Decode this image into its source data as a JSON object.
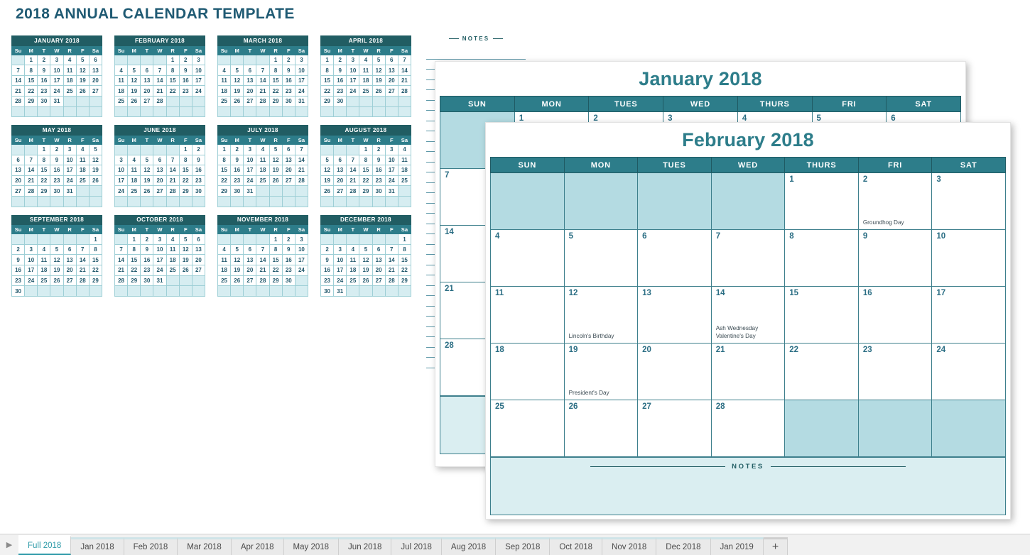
{
  "page": {
    "title": "2018 ANNUAL CALENDAR TEMPLATE",
    "notes_label": "NOTES"
  },
  "colors": {
    "header_teal": "#2d7d8a",
    "title_teal": "#215d63",
    "shaded_cell": "#b4dbe2",
    "mini_blank": "#d6edf1",
    "notes_bg": "#daeef1"
  },
  "mini_calendars": {
    "day_headers": [
      "Su",
      "M",
      "T",
      "W",
      "R",
      "F",
      "Sa"
    ],
    "months": [
      {
        "title": "JANUARY 2018",
        "start": 1,
        "days": 31
      },
      {
        "title": "FEBRUARY 2018",
        "start": 4,
        "days": 28
      },
      {
        "title": "MARCH 2018",
        "start": 4,
        "days": 31
      },
      {
        "title": "APRIL 2018",
        "start": 0,
        "days": 30
      },
      {
        "title": "MAY 2018",
        "start": 2,
        "days": 31
      },
      {
        "title": "JUNE 2018",
        "start": 5,
        "days": 30
      },
      {
        "title": "JULY 2018",
        "start": 0,
        "days": 31
      },
      {
        "title": "AUGUST 2018",
        "start": 3,
        "days": 31
      },
      {
        "title": "SEPTEMBER 2018",
        "start": 6,
        "days": 30
      },
      {
        "title": "OCTOBER 2018",
        "start": 1,
        "days": 31
      },
      {
        "title": "NOVEMBER 2018",
        "start": 4,
        "days": 30
      },
      {
        "title": "DECEMBER 2018",
        "start": 6,
        "days": 31
      }
    ]
  },
  "sheets": [
    {
      "id": "jan",
      "title": "January 2018",
      "day_headers": [
        "SUN",
        "MON",
        "TUES",
        "WED",
        "THURS",
        "FRI",
        "SAT"
      ],
      "start": 1,
      "days": 31,
      "events": {}
    },
    {
      "id": "feb",
      "title": "February 2018",
      "day_headers": [
        "SUN",
        "MON",
        "TUES",
        "WED",
        "THURS",
        "FRI",
        "SAT"
      ],
      "start": 4,
      "days": 28,
      "events": {
        "2": "Groundhog Day",
        "12": "Lincoln's Birthday",
        "14": "Ash Wednesday\nValentine's Day",
        "19": "President's Day"
      }
    }
  ],
  "tabbar": {
    "arrow": "▶",
    "add_label": "+",
    "tabs": [
      {
        "label": "Full 2018",
        "active": true
      },
      {
        "label": "Jan 2018",
        "active": false
      },
      {
        "label": "Feb 2018",
        "active": false
      },
      {
        "label": "Mar 2018",
        "active": false
      },
      {
        "label": "Apr 2018",
        "active": false
      },
      {
        "label": "May 2018",
        "active": false
      },
      {
        "label": "Jun 2018",
        "active": false
      },
      {
        "label": "Jul 2018",
        "active": false
      },
      {
        "label": "Aug 2018",
        "active": false
      },
      {
        "label": "Sep 2018",
        "active": false
      },
      {
        "label": "Oct 2018",
        "active": false
      },
      {
        "label": "Nov 2018",
        "active": false
      },
      {
        "label": "Dec 2018",
        "active": false
      },
      {
        "label": "Jan 2019",
        "active": false
      }
    ]
  }
}
